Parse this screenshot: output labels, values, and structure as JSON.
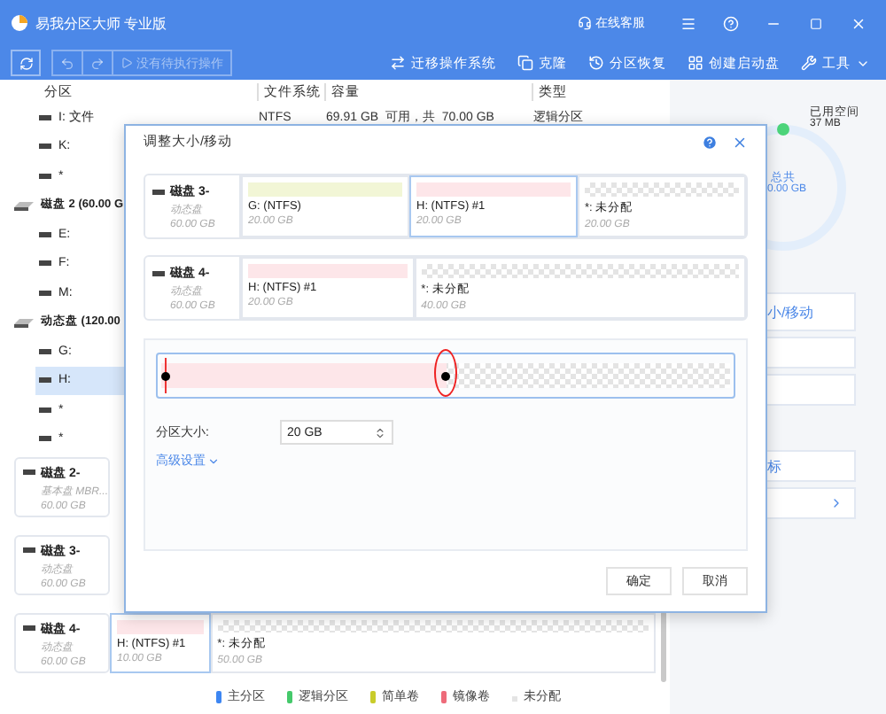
{
  "app": {
    "title": "易我分区大师 专业版",
    "support": "在线客服"
  },
  "toolbar": {
    "pending": "没有待执行操作",
    "actions": [
      {
        "kind": "migrate",
        "label": "迁移操作系统"
      },
      {
        "kind": "clone",
        "label": "克隆"
      },
      {
        "kind": "recover",
        "label": "分区恢复"
      },
      {
        "kind": "boot",
        "label": "创建启动盘"
      },
      {
        "kind": "tools",
        "label": "工具"
      }
    ]
  },
  "table": {
    "columns": [
      "分区",
      "文件系统",
      "容量",
      "类型"
    ]
  },
  "tree": [
    {
      "kind": "partition",
      "label": "I: 文件",
      "file_system": "NTFS",
      "capacity": "69.91 GB  可用，共  70.00 GB",
      "type": "逻辑分区",
      "selected": false
    },
    {
      "kind": "partition",
      "label": "K:",
      "selected": false
    },
    {
      "kind": "partition",
      "label": "*",
      "selected": false
    },
    {
      "kind": "disk",
      "label": "磁盘 2 (60.00 G",
      "children": [
        {
          "kind": "partition",
          "label": "E:",
          "selected": false
        },
        {
          "kind": "partition",
          "label": "F:",
          "selected": false
        },
        {
          "kind": "partition",
          "label": "M:",
          "selected": false
        }
      ]
    },
    {
      "kind": "disk",
      "label": "动态盘 (120.00",
      "children": [
        {
          "kind": "partition",
          "label": "G:",
          "selected": false
        },
        {
          "kind": "partition",
          "label": "H:",
          "selected": true
        },
        {
          "kind": "partition",
          "label": "*",
          "selected": false
        },
        {
          "kind": "partition",
          "label": "*",
          "selected": false
        }
      ]
    }
  ],
  "disks": [
    {
      "name": "磁盘 2-",
      "type": "基本盘 MBR...",
      "size": "60.00 GB"
    },
    {
      "name": "磁盘 3-",
      "type": "动态盘",
      "size": "60.00 GB"
    },
    {
      "name": "磁盘 4-",
      "type": "动态盘",
      "size": "60.00 GB",
      "partitions": [
        {
          "kind": "mirror",
          "label": "H:  (NTFS) #1",
          "size": "10.00 GB",
          "selected": true
        },
        {
          "kind": "unallocated",
          "label": "*: 未分配",
          "size": "50.00 GB",
          "selected": false
        }
      ]
    }
  ],
  "legend": [
    {
      "kind": "color",
      "label": "主分区",
      "color": "#3d86f2"
    },
    {
      "kind": "color",
      "label": "逻辑分区",
      "color": "#45c96b"
    },
    {
      "kind": "color",
      "label": "简单卷",
      "color": "#c9cc2a"
    },
    {
      "kind": "color",
      "label": "镜像卷",
      "color": "#ee6b7a"
    },
    {
      "kind": "unallocated",
      "label": "未分配"
    }
  ],
  "side": {
    "used_label": "已用空间",
    "used": "37 MB",
    "total_label": "总共",
    "total": "0.00 GB",
    "actions": [
      {
        "kind": "text",
        "label": "小/移动"
      },
      {
        "kind": "blank"
      },
      {
        "kind": "blank"
      },
      {
        "kind": "text",
        "label": "标"
      },
      {
        "kind": "more"
      }
    ]
  },
  "dialog": {
    "title": "调整大小/移动",
    "disks": [
      {
        "name": "磁盘 3-",
        "type": "动态盘",
        "size": "60.00 GB",
        "partitions": [
          {
            "kind": "simple",
            "label": "G:  (NTFS)",
            "size": "20.00 GB",
            "selected": false
          },
          {
            "kind": "mirror",
            "label": "H:  (NTFS) #1",
            "size": "20.00 GB",
            "selected": true
          },
          {
            "kind": "unallocated",
            "label": "*: 未分配",
            "size": "20.00 GB",
            "selected": false
          }
        ]
      },
      {
        "name": "磁盘 4-",
        "type": "动态盘",
        "size": "60.00 GB",
        "partitions": [
          {
            "kind": "mirror",
            "label": "H:  (NTFS) #1",
            "size": "20.00 GB",
            "selected": false
          },
          {
            "kind": "unallocated",
            "label": "*: 未分配",
            "size": "40.00 GB",
            "selected": false
          }
        ]
      }
    ],
    "slider": {
      "level": 0.5
    },
    "size_label": "分区大小:",
    "size_value": "20 GB",
    "advanced": "高级设置",
    "buttons": [
      "确定",
      "取消"
    ]
  }
}
